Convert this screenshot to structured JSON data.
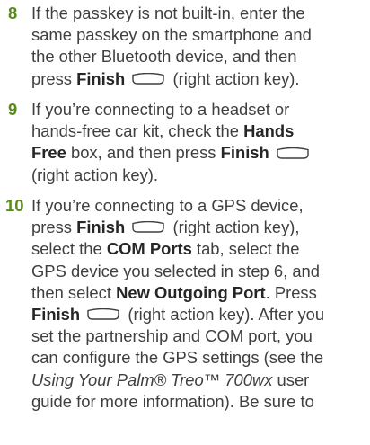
{
  "steps": [
    {
      "number": "8",
      "text_1": "If the passkey is not built-in, enter the",
      "text_2": "same passkey on the smartphone and",
      "text_3": "the other Bluetooth device, and then",
      "text_4a": "press ",
      "bold_finish": "Finish",
      "text_4b": " (right action key)."
    },
    {
      "number": "9",
      "text_1": "If you’re connecting to a headset or",
      "text_2a": "hands-free car kit, check the ",
      "bold_hands": "Hands",
      "bold_free": "Free",
      "text_3a": " box, and then press ",
      "bold_finish": "Finish",
      "text_4": "(right action key)."
    },
    {
      "number": "10",
      "text_1": "If you’re connecting to a GPS device,",
      "text_2a": "press ",
      "bold_finish_1": "Finish",
      "text_2b": " (right action key),",
      "text_3a": "select the ",
      "bold_com_ports": "COM Ports",
      "text_3b": " tab, select the",
      "text_4": "GPS device you selected in step 6, and",
      "text_5a": "then select ",
      "bold_new_outgoing": "New Outgoing Port",
      "text_5b": ". Press",
      "bold_finish_2": "Finish",
      "text_6b": " (right action key). After you",
      "text_7": "set the partnership and COM port, you",
      "text_8": "can configure the GPS settings (see the",
      "italic_guide": "Using Your Palm® Treo™ 700wx",
      "text_9b": " user",
      "text_10": "guide for more information). Be sure to"
    }
  ],
  "icons": {
    "right_action_key": "right-action-key-icon"
  }
}
